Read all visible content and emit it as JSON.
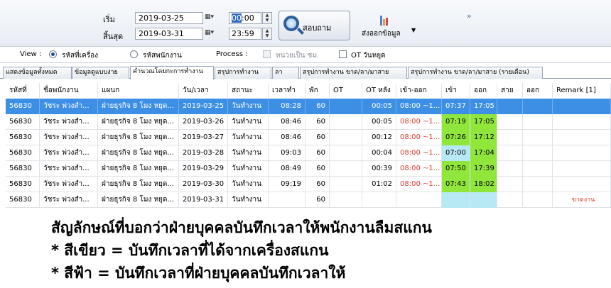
{
  "filter": {
    "start_label": "เริ่ม",
    "end_label": "สิ้นสุด",
    "start_date": "2019-03-25",
    "end_date": "2019-03-31",
    "start_time_hh": "00",
    "start_time_rest": ":00",
    "end_time": "23:59",
    "search_label": "สอบถาม",
    "export_label": "ส่งออกข้อมูล",
    "more_glyph": "»"
  },
  "options": {
    "view_label": "View :",
    "view_by_machine": "รหัสที่เครื่อง",
    "view_by_employee": "รหัสพนักงาน",
    "process_label": "Process :",
    "unit_hours": "หน่วยเป็น ชม.",
    "ot_holiday": "OT วันหยุด",
    "selected_view": "machine"
  },
  "tabs": [
    "แสดงข้อมูลทั้งหมด",
    "ข้อมูลดูแบบง่าย",
    "คำนวณโดยกะการทำงาน",
    "สรุปการทำงาน",
    "ลา",
    "สรุปการทำงาน ขาด/ลา/มาสาย",
    "สรุปการทำงาน ขาด/ลา/มาสาย (รายเดือน)"
  ],
  "active_tab": 2,
  "table": {
    "columns": [
      "รหัสที่",
      "ชื่อพนักงาน",
      "แผนก",
      "วัน/เวลา",
      "สถานะ",
      "เวลาทำ",
      "พัก",
      "OT",
      "OT หลัง",
      "เข้า-ออก",
      "เข้า",
      "ออก",
      "สาย",
      "ออก",
      "Remark [1]"
    ],
    "rows": [
      {
        "id": "56830",
        "name": "วัชระ พ่วงสำ...",
        "dept": "ฝ่ายธุรกิจ 8 โมง หยุด...",
        "date": "2019-03-25",
        "status": "วันทำงาน",
        "work": "08:28",
        "break": "60",
        "ot": "",
        "ot_after": "00:05",
        "shift": "08:00 ~1...",
        "in": "07:37",
        "out": "17:05",
        "late": "",
        "early": "",
        "remark": "",
        "in_color": "green",
        "out_color": "green"
      },
      {
        "id": "56830",
        "name": "วัชระ พ่วงสำ...",
        "dept": "ฝ่ายธุรกิจ 8 โมง หยุด...",
        "date": "2019-03-26",
        "status": "วันทำงาน",
        "work": "08:46",
        "break": "60",
        "ot": "",
        "ot_after": "00:05",
        "shift": "08:00 ~1...",
        "in": "07:19",
        "out": "17:05",
        "late": "",
        "early": "",
        "remark": "",
        "in_color": "green",
        "out_color": "green"
      },
      {
        "id": "56830",
        "name": "วัชระ พ่วงสำ...",
        "dept": "ฝ่ายธุรกิจ 8 โมง หยุด...",
        "date": "2019-03-27",
        "status": "วันทำงาน",
        "work": "08:46",
        "break": "60",
        "ot": "",
        "ot_after": "00:12",
        "shift": "08:00 ~1...",
        "in": "07:26",
        "out": "17:12",
        "late": "",
        "early": "",
        "remark": "",
        "in_color": "green",
        "out_color": "green"
      },
      {
        "id": "56830",
        "name": "วัชระ พ่วงสำ...",
        "dept": "ฝ่ายธุรกิจ 8 โมง หยุด...",
        "date": "2019-03-28",
        "status": "วันทำงาน",
        "work": "09:03",
        "break": "60",
        "ot": "",
        "ot_after": "00:04",
        "shift": "08:00 ~1...",
        "in": "07:00",
        "out": "17:04",
        "late": "",
        "early": "",
        "remark": "",
        "in_color": "blue",
        "out_color": "green"
      },
      {
        "id": "56830",
        "name": "วัชระ พ่วงสำ...",
        "dept": "ฝ่ายธุรกิจ 8 โมง หยุด...",
        "date": "2019-03-29",
        "status": "วันทำงาน",
        "work": "08:49",
        "break": "60",
        "ot": "",
        "ot_after": "00:39",
        "shift": "08:00 ~1...",
        "in": "07:50",
        "out": "17:39",
        "late": "",
        "early": "",
        "remark": "",
        "in_color": "green",
        "out_color": "green"
      },
      {
        "id": "56830",
        "name": "วัชระ พ่วงสำ...",
        "dept": "ฝ่ายธุรกิจ 8 โมง หยุด...",
        "date": "2019-03-30",
        "status": "วันทำงาน",
        "work": "09:19",
        "break": "60",
        "ot": "",
        "ot_after": "01:02",
        "shift": "08:00 ~1...",
        "in": "07:43",
        "out": "18:02",
        "late": "",
        "early": "",
        "remark": "",
        "in_color": "green",
        "out_color": "green"
      },
      {
        "id": "56830",
        "name": "วัชระ พ่วงสำ...",
        "dept": "ฝ่ายธุรกิจ 8 โมง หยุด...",
        "date": "2019-03-31",
        "status": "วันทำงาน",
        "work": "",
        "break": "60",
        "ot": "",
        "ot_after": "",
        "shift": "",
        "in": "",
        "out": "",
        "late": "",
        "early": "",
        "remark": "ขาดงาน",
        "in_color": "blue",
        "out_color": "blue"
      }
    ],
    "selected_row": 0
  },
  "colors": {
    "green": "#91e63c",
    "blue": "#b7e9f5",
    "selection": "#3d8fe5",
    "red_text": "#e23b2e"
  },
  "notes": [
    "สัญลักษณ์ที่บอกว่าฝ่ายบุคคลบันทึกเวลาให้พนักงานลืมสแกน",
    "* สีเขียว = บันทึกเวลาที่ได้จากเครื่องสแกน",
    "* สีฟ้า = บันทึกเวลาที่ฝ่ายบุคคลบันทึกเวลาให้"
  ]
}
